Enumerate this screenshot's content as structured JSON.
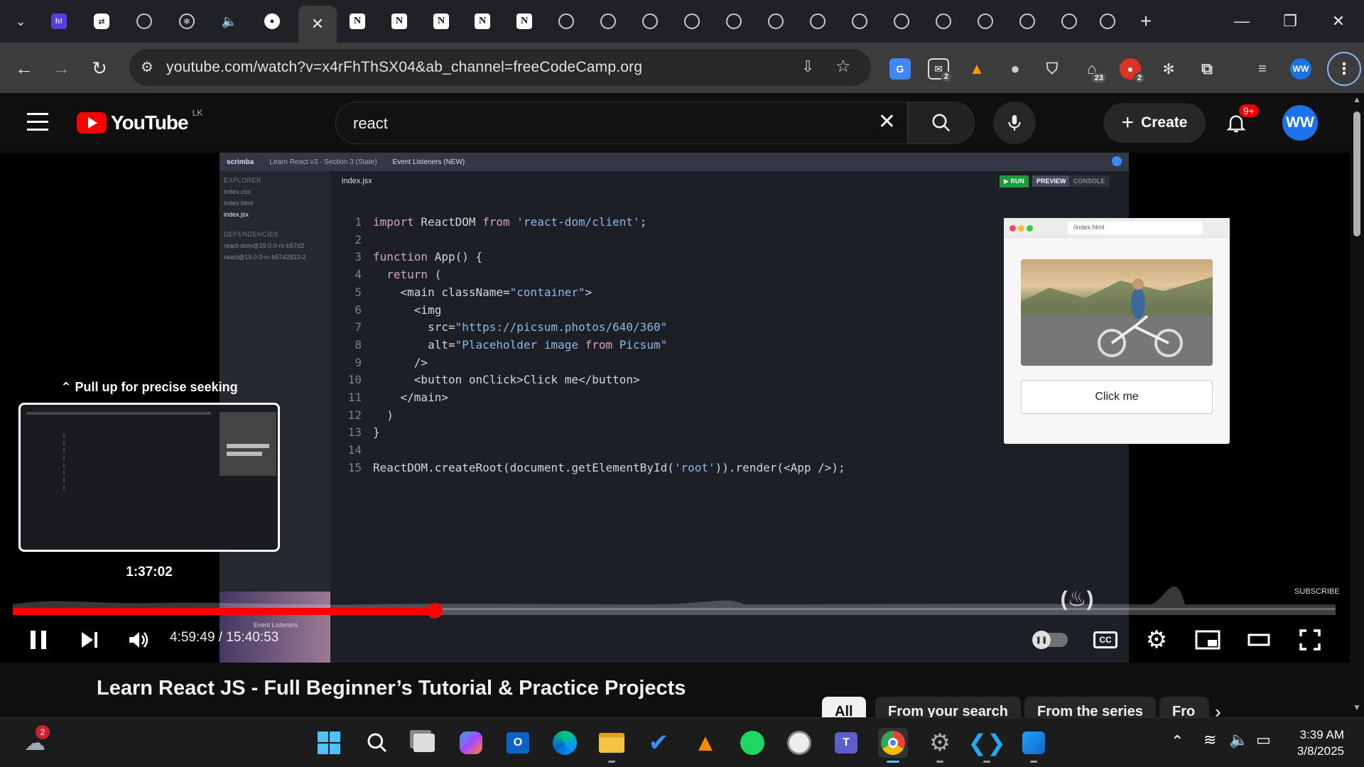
{
  "browser": {
    "url": "youtube.com/watch?v=x4rFhThSX04&ab_channel=freeCodeCamp.org",
    "extension_badges": {
      "mail": "2",
      "home": "23",
      "red": "2"
    },
    "profile_initials": "WW"
  },
  "youtube": {
    "logo_text": "YouTube",
    "region": "LK",
    "search_value": "react",
    "create_label": "Create",
    "notif_count": "9+",
    "avatar_initials": "WW"
  },
  "video_frame": {
    "breadcrumb": [
      "scrimba",
      "Learn React v3 - Section 3 (State)",
      "Event Listeners (NEW)"
    ],
    "explorer_label": "EXPLORER",
    "files": [
      "index.css",
      "index.html",
      "index.jsx"
    ],
    "dependencies_label": "DEPENDENCIES",
    "dependencies": [
      "react-dom@19.0.0-rc-b57d2",
      "react@19.0.0-rc-b57d2823-2"
    ],
    "active_file": "index.jsx",
    "run_label": "▶ RUN",
    "preview_label": "PREVIEW",
    "console_label": "CONSOLE",
    "code_lines": [
      "import ReactDOM from 'react-dom/client';",
      "",
      "function App() {",
      "  return (",
      "    <main className=\"container\">",
      "      <img",
      "        src=\"https://picsum.photos/640/360\"",
      "        alt=\"Placeholder image from Picsum\"",
      "      />",
      "      <button onClick>Click me</button>",
      "    </main>",
      "  )",
      "}",
      "",
      "ReactDOM.createRoot(document.getElementById('root')).render(<App />);"
    ],
    "preview_url": "/index.html",
    "preview_button": "Click me",
    "subscribe_label": "SUBSCRIBE"
  },
  "player": {
    "seek_hint": "Pull up for precise seeking",
    "seek_time": "1:37:02",
    "current_time": "4:59:49",
    "total_time": "15:40:53",
    "progress_fraction": 0.319,
    "chapter_label": "Event Listeners"
  },
  "below": {
    "title": "Learn React JS - Full Beginner’s Tutorial & Practice Projects",
    "chips": [
      "All",
      "From your search",
      "From the series",
      "Fro"
    ]
  },
  "taskbar": {
    "weather_badge": "2",
    "time": "3:39 AM",
    "date": "3/8/2025"
  }
}
